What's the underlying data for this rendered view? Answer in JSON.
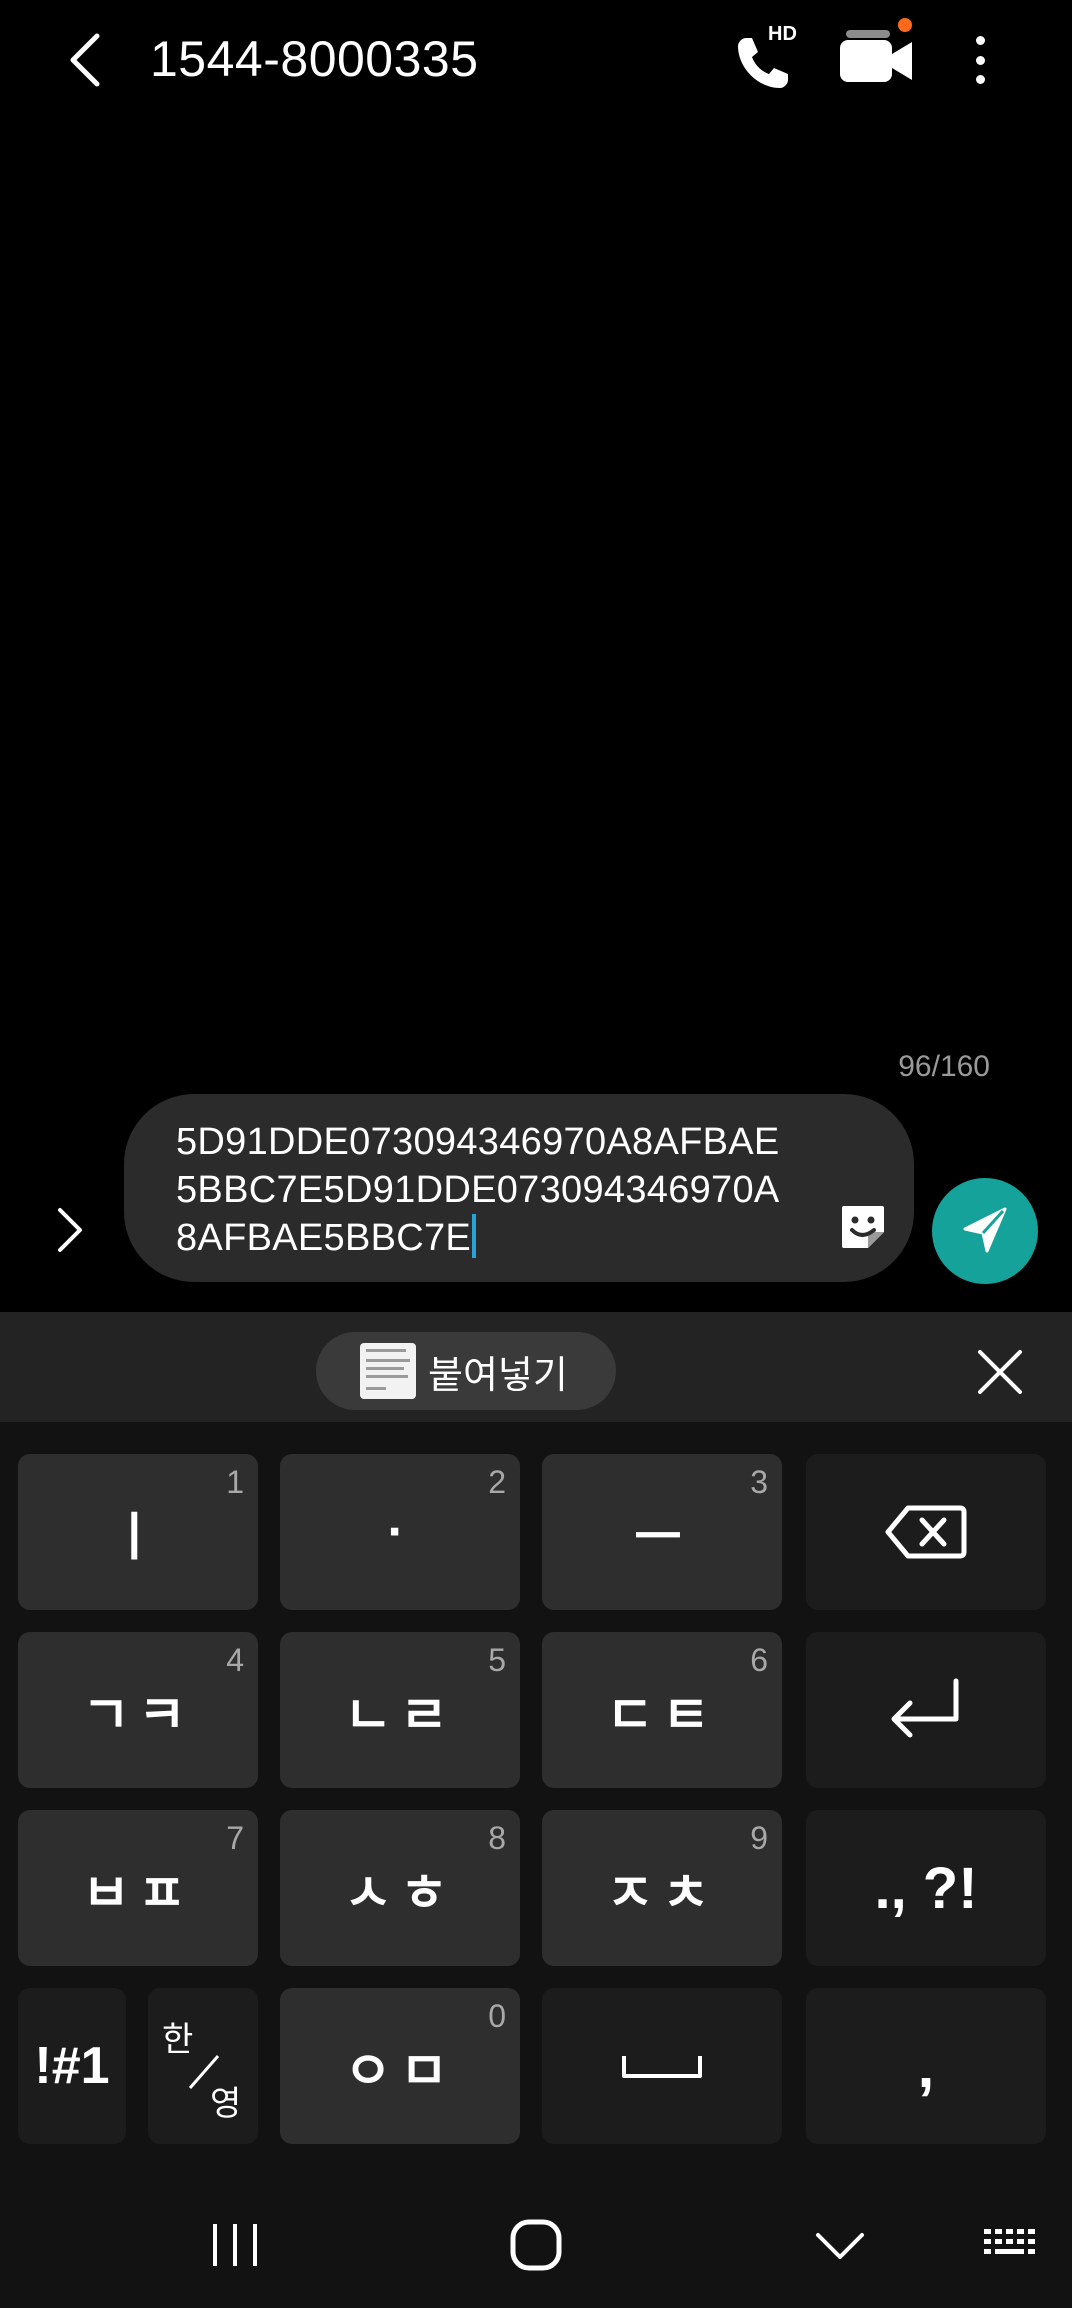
{
  "header": {
    "title": "1544-8000335",
    "back_icon": "chevron-left-icon",
    "hd_call_badge": "HD",
    "video_notification_color": "#ff6a1a"
  },
  "composer": {
    "char_count": "96/160",
    "text": "5D91DDE073094346970A8AFBAE5BBC7E5D91DDE073094346970A8AFBAE5BBC7E",
    "send_color": "#15a29a",
    "cursor_color": "#2aa3d8"
  },
  "keyboard": {
    "toolbar": {
      "paste_label": "붙여넣기"
    },
    "keys": {
      "k1": {
        "main": "ㅣ",
        "num": "1"
      },
      "k2": {
        "main": "·",
        "num": "2"
      },
      "k3": {
        "main": "ㅡ",
        "num": "3"
      },
      "k4": {
        "main": "ㄱㅋ",
        "num": "4"
      },
      "k5": {
        "main": "ㄴㄹ",
        "num": "5"
      },
      "k6": {
        "main": "ㄷㅌ",
        "num": "6"
      },
      "k7": {
        "main": "ㅂㅍ",
        "num": "7"
      },
      "k8": {
        "main": "ㅅㅎ",
        "num": "8"
      },
      "k9": {
        "main": "ㅈㅊ",
        "num": "9"
      },
      "k0": {
        "main": "ㅇㅁ",
        "num": "0"
      },
      "punct": "., ?!",
      "symbols": "!#1",
      "lang_top": "한",
      "lang_bottom": "영",
      "comma": ","
    }
  }
}
